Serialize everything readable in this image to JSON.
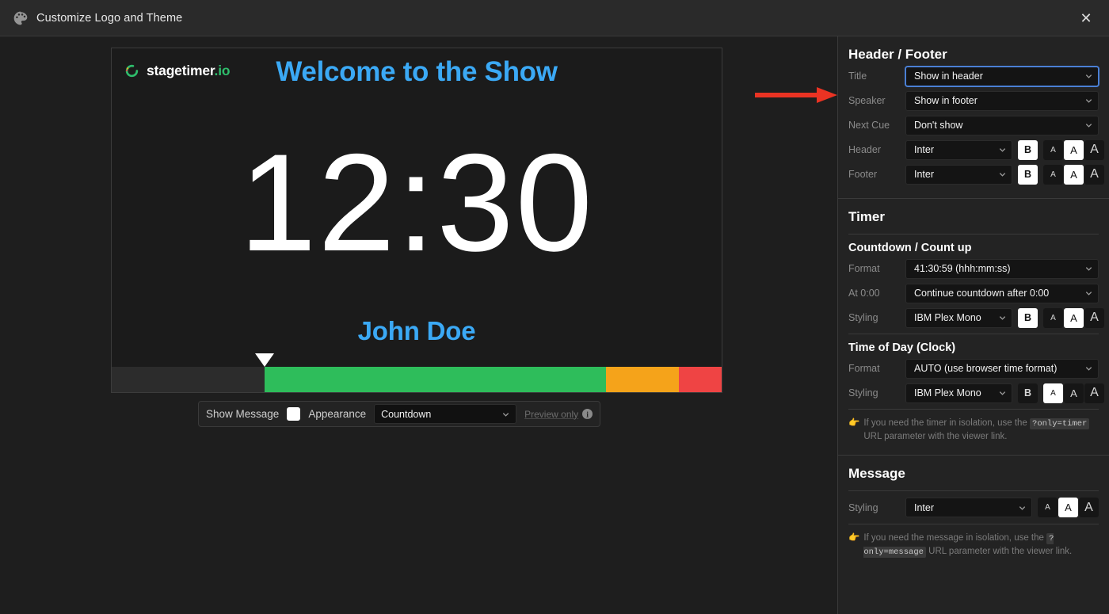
{
  "window": {
    "title": "Customize Logo and Theme",
    "icon": "palette-icon",
    "close_label": "✕"
  },
  "preview": {
    "logo_name": "stagetimer",
    "logo_tld": ".io",
    "header_text": "Welcome to the Show",
    "timer_text": "12:30",
    "footer_text": "John Doe",
    "progress": {
      "marker_position_pct": 25,
      "segments": [
        {
          "name": "elapsed",
          "color": "#2c2c2c",
          "pct": 25
        },
        {
          "name": "normal",
          "color": "#2ebd5b",
          "pct": 56
        },
        {
          "name": "warning",
          "color": "#f5a31a",
          "pct": 12
        },
        {
          "name": "danger",
          "color": "#ef4444",
          "pct": 7
        }
      ]
    }
  },
  "controls": {
    "show_message_label": "Show Message",
    "show_message_checked": true,
    "appearance_label": "Appearance",
    "appearance_value": "Countdown",
    "preview_only_label": "Preview only",
    "info_badge": "i"
  },
  "annotation": {
    "arrow_color": "#ea3323",
    "points_to": "Header / Footer"
  },
  "panel": {
    "header_footer": {
      "title": "Header / Footer",
      "rows": [
        {
          "label": "Title",
          "value": "Show in header",
          "focused": true
        },
        {
          "label": "Speaker",
          "value": "Show in footer",
          "focused": false
        },
        {
          "label": "Next Cue",
          "value": "Don't show",
          "focused": false
        }
      ],
      "font_rows": [
        {
          "label": "Header",
          "font": "Inter",
          "bold_label": "B",
          "bold_active": true,
          "sizes": [
            "A",
            "A",
            "A"
          ],
          "size_active_index": 1
        },
        {
          "label": "Footer",
          "font": "Inter",
          "bold_label": "B",
          "bold_active": true,
          "sizes": [
            "A",
            "A",
            "A"
          ],
          "size_active_index": 1
        }
      ]
    },
    "timer": {
      "title": "Timer",
      "countdown": {
        "subtitle": "Countdown / Count up",
        "format_label": "Format",
        "format_value": "41:30:59 (hhh:mm:ss)",
        "at_zero_label": "At 0:00",
        "at_zero_value": "Continue countdown after 0:00",
        "styling_label": "Styling",
        "styling_font": "IBM Plex Mono",
        "bold_label": "B",
        "bold_active": true,
        "sizes": [
          "A",
          "A",
          "A"
        ],
        "size_active_index": 1
      },
      "clock": {
        "subtitle": "Time of Day (Clock)",
        "format_label": "Format",
        "format_value": "AUTO (use browser time format)",
        "styling_label": "Styling",
        "styling_font": "IBM Plex Mono",
        "bold_label": "B",
        "bold_active": false,
        "sizes": [
          "A",
          "A",
          "A"
        ],
        "size_active_index": 0
      },
      "hint_emoji": "👉",
      "hint_pre": "If you need the timer in isolation, use the",
      "hint_code": "?only=timer",
      "hint_post": "URL parameter with the viewer link."
    },
    "message": {
      "title": "Message",
      "styling_label": "Styling",
      "styling_font": "Inter",
      "sizes": [
        "A",
        "A",
        "A"
      ],
      "size_active_index": 1,
      "hint_emoji": "👉",
      "hint_pre": "If you need the message in isolation, use the",
      "hint_code": "?only=message",
      "hint_post": "URL parameter with the viewer link."
    }
  },
  "colors": {
    "accent_blue": "#3ba9f5",
    "logo_green": "#2ebd6b",
    "progress_green": "#2ebd5b",
    "progress_orange": "#f5a31a",
    "progress_red": "#ef4444",
    "focus_ring": "#4a7fd4",
    "arrow_red": "#ea3323"
  }
}
